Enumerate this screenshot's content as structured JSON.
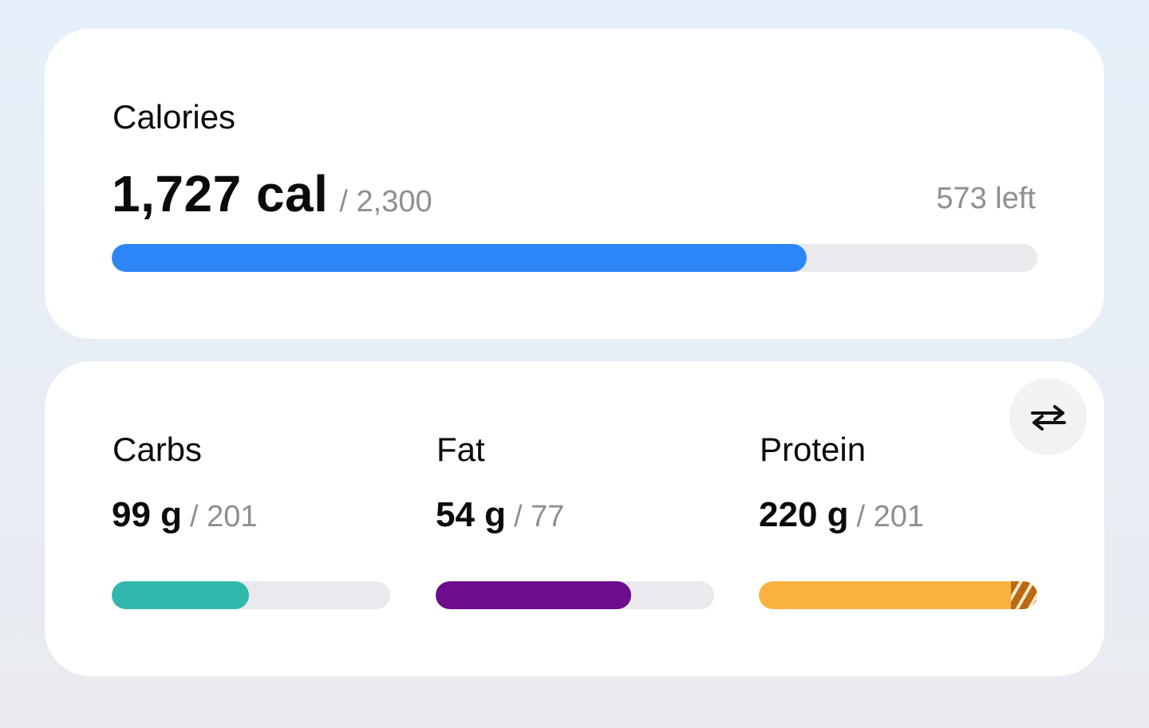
{
  "calories": {
    "title": "Calories",
    "value": "1,727 cal",
    "goal": "/ 2,300",
    "left": "573 left",
    "progress": 0.7509,
    "color": "#2d86f8"
  },
  "macros": {
    "swap_icon": "swap-arrows-icon",
    "items": [
      {
        "title": "Carbs",
        "value": "99 g",
        "goal": "/ 201",
        "progress": 0.4925,
        "color": "#2fb8ab"
      },
      {
        "title": "Fat",
        "value": "54 g",
        "goal": "/ 77",
        "progress": 0.7013,
        "color": "#6b0d8c"
      },
      {
        "title": "Protein",
        "value": "220 g",
        "goal": "/ 201",
        "progress": 1.0,
        "over": 0.0945,
        "color": "#fbb240",
        "over_color": "#b86a12"
      }
    ]
  }
}
